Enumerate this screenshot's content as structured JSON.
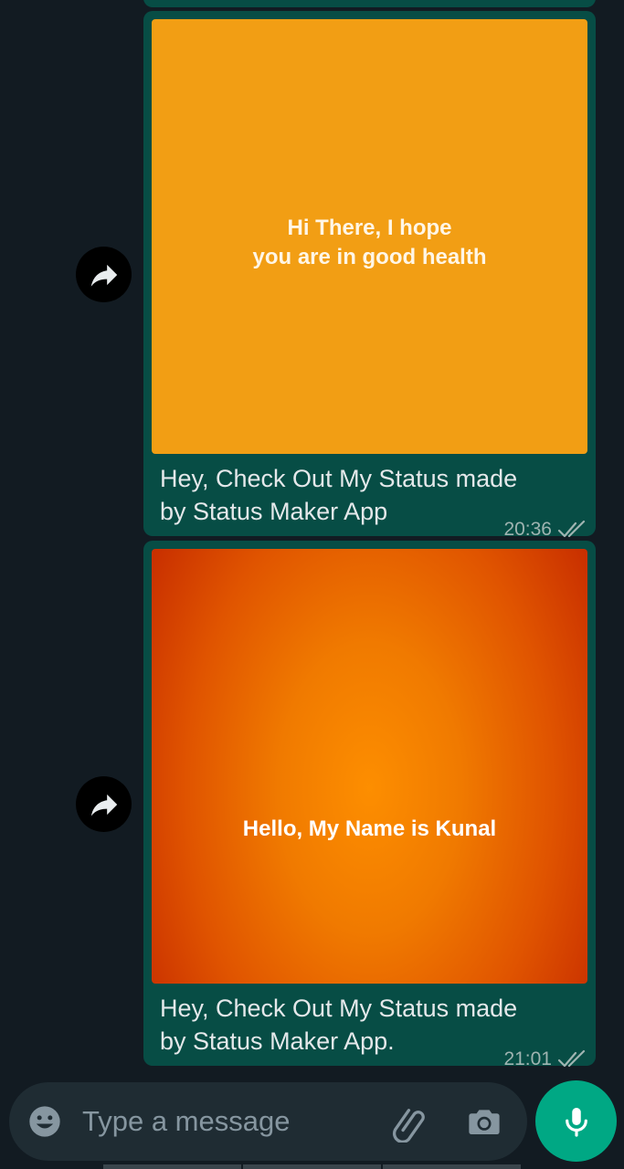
{
  "messages": [
    {
      "status_image_text_line1": "Hi There, I hope",
      "status_image_text_line2": "you are in good health",
      "caption_line1": "Hey, Check Out My Status made",
      "caption_line2": "by Status Maker App",
      "time": "20:36",
      "status_icon": "double-check-icon",
      "image_color": "#f29e14"
    },
    {
      "status_image_text_line1": "Hello, My Name is Kunal",
      "caption_line1": "Hey, Check Out My Status made",
      "caption_line2": "by Status Maker App.",
      "time": "21:01",
      "status_icon": "double-check-icon",
      "image_color": "#fd8e00"
    }
  ],
  "composer": {
    "placeholder": "Type a message",
    "value": "",
    "icons": [
      "emoji-icon",
      "attach-icon",
      "camera-icon",
      "mic-icon"
    ]
  },
  "colors": {
    "background": "#121b22",
    "bubble": "#074d45",
    "accent": "#00a884",
    "input_bar": "#1f2c33"
  }
}
